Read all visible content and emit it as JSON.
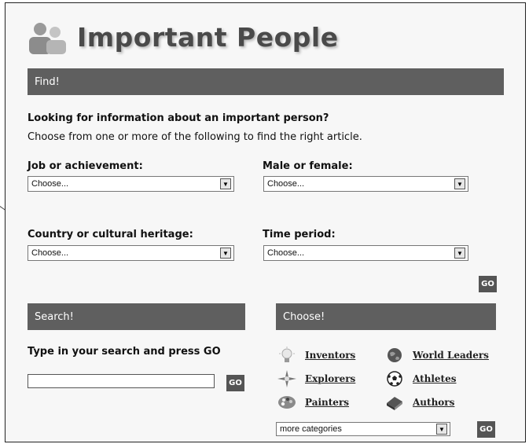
{
  "header": {
    "title": "Important People"
  },
  "find": {
    "bar_label": "Find!",
    "intro_heading": "Looking for information about an important person?",
    "intro_text": "Choose from one or more of the following to find the right article.",
    "fields": {
      "job": {
        "label": "Job or achievement:",
        "value": "Choose..."
      },
      "gender": {
        "label": "Male or female:",
        "value": "Choose..."
      },
      "country": {
        "label": "Country or cultural heritage:",
        "value": "Choose..."
      },
      "period": {
        "label": "Time period:",
        "value": "Choose..."
      }
    },
    "go_label": "GO"
  },
  "search": {
    "bar_label": "Search!",
    "prompt": "Type in your search and press GO",
    "input_value": "",
    "go_label": "GO"
  },
  "choose": {
    "bar_label": "Choose!",
    "categories": [
      {
        "label": "Inventors",
        "icon": "lightbulb-icon"
      },
      {
        "label": "World Leaders",
        "icon": "globe-icon"
      },
      {
        "label": "Explorers",
        "icon": "compass-icon"
      },
      {
        "label": "Athletes",
        "icon": "soccer-ball-icon"
      },
      {
        "label": "Painters",
        "icon": "palette-icon"
      },
      {
        "label": "Authors",
        "icon": "book-icon"
      }
    ],
    "more_select_value": "more categories",
    "go_label": "GO"
  },
  "colors": {
    "bar_bg": "#5f5f5f",
    "page_bg": "#f7f7f7",
    "title": "#4a4a4a"
  }
}
